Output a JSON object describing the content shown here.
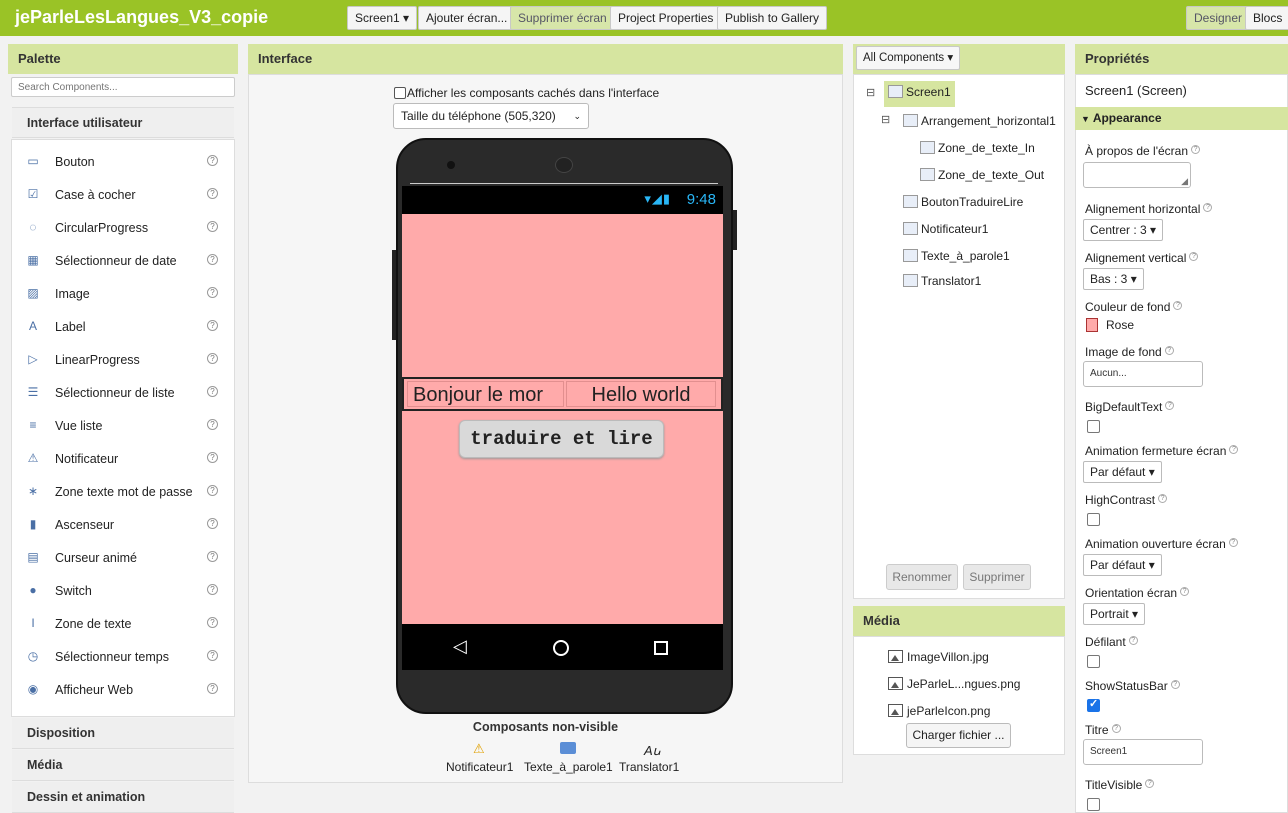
{
  "app": {
    "title": "jeParleLesLangues_V3_copie"
  },
  "toolbar": {
    "screen_select": "Screen1 ▾",
    "add_screen": "Ajouter écran...",
    "remove_screen": "Supprimer écran",
    "project_properties": "Project Properties",
    "publish": "Publish to Gallery",
    "designer": "Designer",
    "blocks": "Blocs"
  },
  "palette": {
    "title": "Palette",
    "search_placeholder": "Search Components...",
    "category_open": "Interface utilisateur",
    "items": [
      {
        "label": "Bouton",
        "icon": "button-icon"
      },
      {
        "label": "Case à cocher",
        "icon": "checkbox-icon"
      },
      {
        "label": "CircularProgress",
        "icon": "circular-progress-icon"
      },
      {
        "label": "Sélectionneur de date",
        "icon": "date-picker-icon"
      },
      {
        "label": "Image",
        "icon": "image-icon"
      },
      {
        "label": "Label",
        "icon": "label-icon"
      },
      {
        "label": "LinearProgress",
        "icon": "linear-progress-icon"
      },
      {
        "label": "Sélectionneur de liste",
        "icon": "list-picker-icon"
      },
      {
        "label": "Vue liste",
        "icon": "list-view-icon"
      },
      {
        "label": "Notificateur",
        "icon": "warning-icon"
      },
      {
        "label": "Zone texte mot de passe",
        "icon": "password-icon"
      },
      {
        "label": "Ascenseur",
        "icon": "slider-icon"
      },
      {
        "label": "Curseur animé",
        "icon": "spinner-icon"
      },
      {
        "label": "Switch",
        "icon": "switch-icon"
      },
      {
        "label": "Zone de texte",
        "icon": "textbox-icon"
      },
      {
        "label": "Sélectionneur temps",
        "icon": "time-picker-icon"
      },
      {
        "label": "Afficheur Web",
        "icon": "globe-icon"
      }
    ],
    "help_glyph": "?",
    "categories": [
      "Disposition",
      "Média",
      "Dessin et animation"
    ]
  },
  "viewer": {
    "title": "Interface",
    "hidden_label": "Afficher les composants cachés dans l'interface",
    "size_select": "Taille du téléphone (505,320)",
    "status_time": "9:48",
    "textbox_in": "Bonjour le mor",
    "textbox_out": "Hello world",
    "button": "traduire et lire",
    "nonvisible_title": "Composants non-visible",
    "nonvisible": [
      "Notificateur1",
      "Texte_à_parole1",
      "Translator1"
    ],
    "screen_color": "#ffaaaa"
  },
  "components": {
    "filter": "All Components ▾",
    "tree": [
      {
        "label": "Screen1",
        "level": 0,
        "selected": true
      },
      {
        "label": "Arrangement_horizontal1",
        "level": 1
      },
      {
        "label": "Zone_de_texte_In",
        "level": 2
      },
      {
        "label": "Zone_de_texte_Out",
        "level": 2
      },
      {
        "label": "BoutonTraduireLire",
        "level": 1
      },
      {
        "label": "Notificateur1",
        "level": 1
      },
      {
        "label": "Texte_à_parole1",
        "level": 1
      },
      {
        "label": "Translator1",
        "level": 1
      }
    ],
    "collapse_glyph": "⊟",
    "rename": "Renommer",
    "delete": "Supprimer"
  },
  "media": {
    "title": "Média",
    "files": [
      "ImageVillon.jpg",
      "JeParleL...ngues.png",
      "jeParleIcon.png"
    ],
    "upload": "Charger fichier ..."
  },
  "properties": {
    "title": "Propriétés",
    "subject": "Screen1 (Screen)",
    "group": "Appearance",
    "about_label": "À propos de l'écran",
    "align_h_label": "Alignement horizontal",
    "align_h_value": "Centrer : 3 ▾",
    "align_v_label": "Alignement vertical",
    "align_v_value": "Bas : 3 ▾",
    "bg_color_label": "Couleur de fond",
    "bg_color_value": "Rose",
    "bg_image_label": "Image de fond",
    "bg_image_value": "Aucun...",
    "big_text_label": "BigDefaultText",
    "close_anim_label": "Animation fermeture écran",
    "close_anim_value": "Par défaut ▾",
    "high_contrast_label": "HighContrast",
    "open_anim_label": "Animation ouverture écran",
    "open_anim_value": "Par défaut ▾",
    "orientation_label": "Orientation écran",
    "orientation_value": "Portrait ▾",
    "scrollable_label": "Défilant",
    "status_bar_label": "ShowStatusBar",
    "title_label": "Titre",
    "title_value": "Screen1",
    "title_visible_label": "TitleVisible",
    "help_glyph": "?"
  }
}
